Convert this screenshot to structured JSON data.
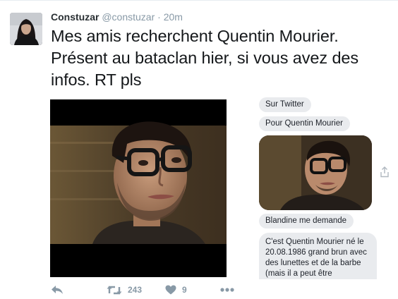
{
  "tweet": {
    "author": {
      "display_name": "Constuzar",
      "screen_name": "@constuzar",
      "separator": "·",
      "timestamp": "20m"
    },
    "text_lines": [
      "Mes amis recherchent Quentin Mourier.",
      "Présent au bataclan hier, si vous avez des",
      "infos. RT pls"
    ],
    "chat_screenshot": {
      "messages": [
        "Sur Twitter",
        "Pour Quentin Mourier",
        "Blandine me demande",
        "C'est Quentin Mourier né le 20.08.1986 grand brun avec des lunettes et de la barbe (mais il a peut être"
      ]
    },
    "actions": {
      "reply_icon": "reply-icon",
      "retweet_icon": "retweet-icon",
      "retweet_count": "243",
      "like_icon": "heart-icon",
      "like_count": "9",
      "more_icon": "more-icon"
    },
    "colors": {
      "text": "#14171a",
      "muted": "#8899a6",
      "bubble": "#e9ebee"
    }
  }
}
